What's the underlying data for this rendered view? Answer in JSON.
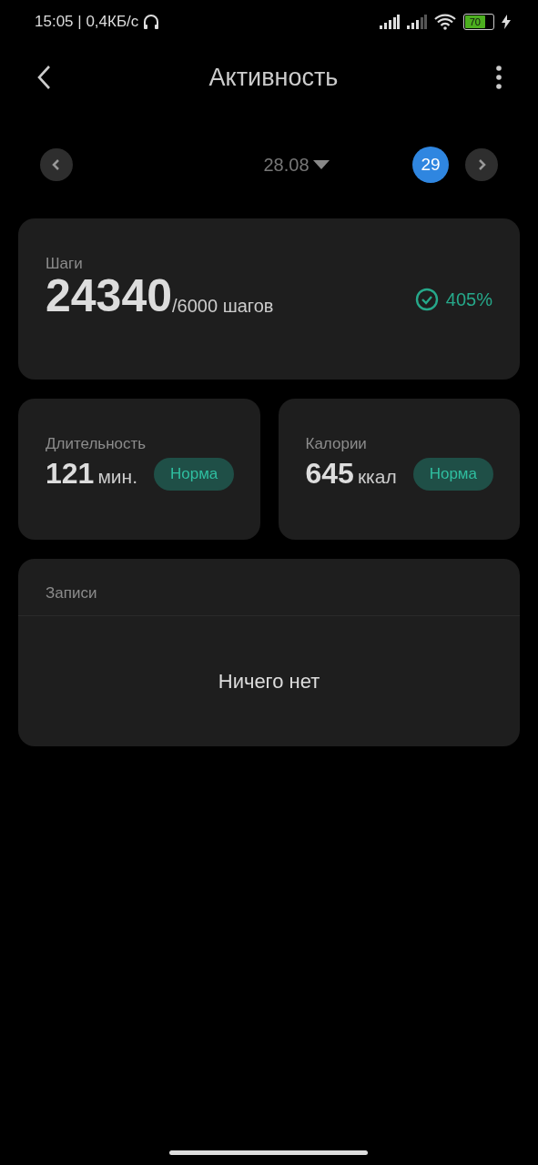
{
  "status_bar": {
    "time": "15:05 | 0,4КБ/с",
    "battery": "70"
  },
  "header": {
    "title": "Активность"
  },
  "date_bar": {
    "date": "28.08",
    "day": "29"
  },
  "steps": {
    "label": "Шаги",
    "value": "24340",
    "goal": "/6000 шагов",
    "percent": "405%",
    "goal_reached": true
  },
  "stats": [
    {
      "label": "Длительность",
      "value": "121",
      "unit": "мин.",
      "badge": "Норма"
    },
    {
      "label": "Калории",
      "value": "645",
      "unit": "ккал",
      "badge": "Норма"
    }
  ],
  "records": {
    "title": "Записи",
    "empty_text": "Ничего нет"
  }
}
